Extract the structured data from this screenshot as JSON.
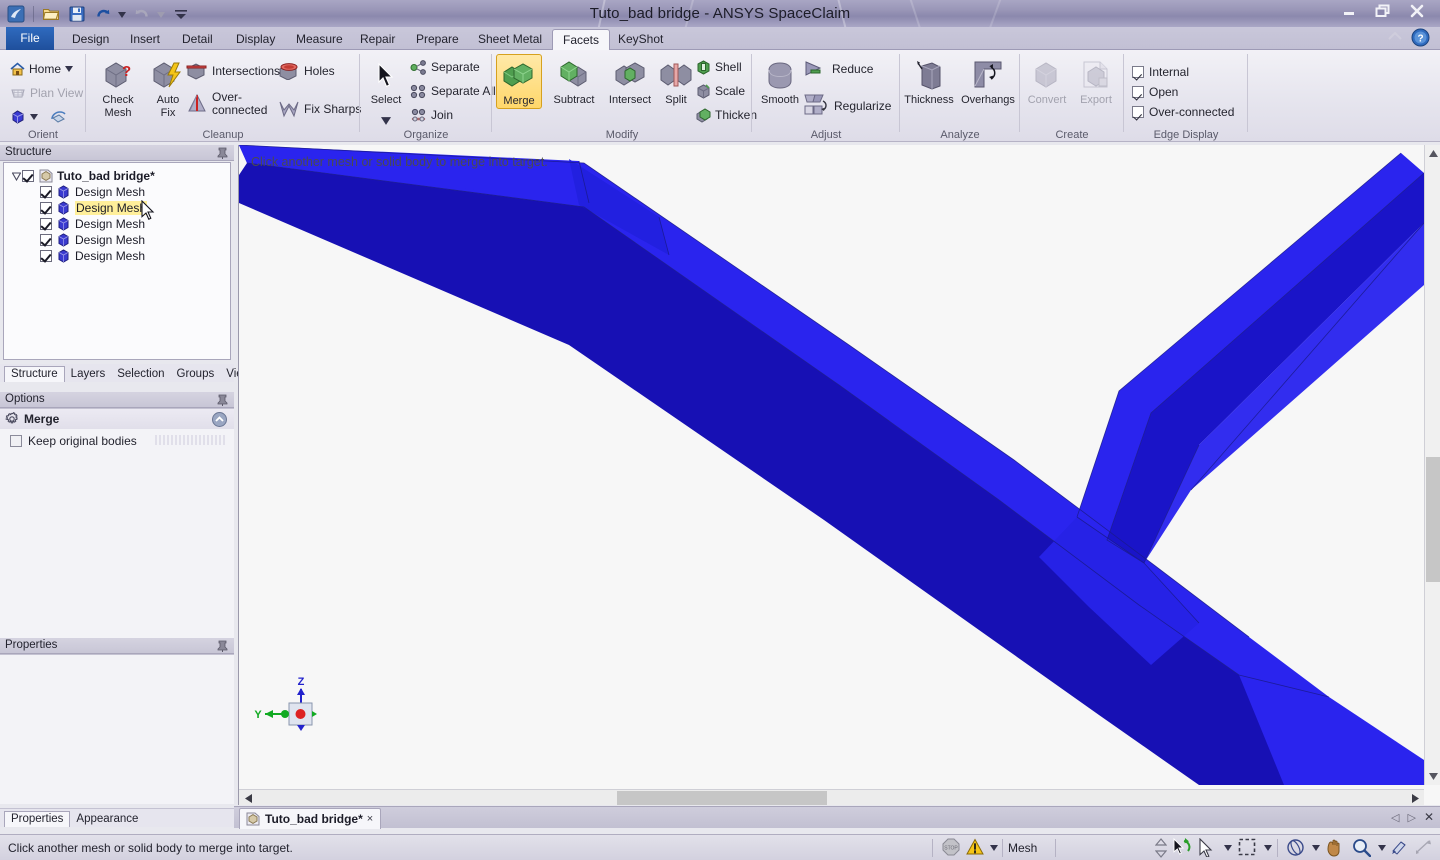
{
  "window": {
    "title": "Tuto_bad bridge - ANSYS SpaceClaim",
    "minimize_label": "Minimize",
    "restore_label": "Restore",
    "close_label": "Close"
  },
  "quick_access": {
    "app_icon": "spaceclaim-logo-icon",
    "items": [
      {
        "name": "open-icon",
        "label": "Open"
      },
      {
        "name": "save-icon",
        "label": "Save"
      },
      {
        "name": "undo-icon",
        "label": "Undo"
      },
      {
        "name": "redo-icon",
        "label": "Redo"
      },
      {
        "name": "customize-qat-icon",
        "label": "Customize Quick Access Toolbar"
      }
    ]
  },
  "tabs": [
    {
      "label": "File",
      "active": false,
      "file": true
    },
    {
      "label": "Design",
      "active": false
    },
    {
      "label": "Insert",
      "active": false
    },
    {
      "label": "Detail",
      "active": false
    },
    {
      "label": "Display",
      "active": false
    },
    {
      "label": "Measure",
      "active": false
    },
    {
      "label": "Repair",
      "active": false
    },
    {
      "label": "Prepare",
      "active": false
    },
    {
      "label": "Sheet Metal",
      "active": false
    },
    {
      "label": "Facets",
      "active": true
    },
    {
      "label": "KeyShot",
      "active": false
    }
  ],
  "ribbon": {
    "groups": [
      {
        "name": "orient",
        "label": "Orient"
      },
      {
        "name": "cleanup",
        "label": "Cleanup"
      },
      {
        "name": "organize",
        "label": "Organize"
      },
      {
        "name": "modify",
        "label": "Modify"
      },
      {
        "name": "adjust",
        "label": "Adjust"
      },
      {
        "name": "analyze",
        "label": "Analyze"
      },
      {
        "name": "create",
        "label": "Create"
      },
      {
        "name": "edge_display",
        "label": "Edge Display"
      }
    ],
    "orient": {
      "home_label": "Home",
      "plan_view_label": "Plan View",
      "view_icon": "view-cube-icon",
      "spin_icon": "spin-view-icon"
    },
    "cleanup": {
      "check_mesh_label": "Check\nMesh",
      "check_mesh_line1": "Check",
      "check_mesh_line2": "Mesh",
      "auto_fix_line1": "Auto",
      "auto_fix_line2": "Fix",
      "intersections_label": "Intersections",
      "holes_label": "Holes",
      "over_connected_line1": "Over-",
      "over_connected_line2": "connected",
      "fix_sharps_label": "Fix Sharps"
    },
    "organize": {
      "select_label": "Select",
      "separate_label": "Separate",
      "separate_all_label": "Separate All",
      "join_label": "Join"
    },
    "modify": {
      "merge_label": "Merge",
      "merge_selected": true,
      "subtract_label": "Subtract",
      "intersect_label": "Intersect",
      "split_label": "Split",
      "shell_label": "Shell",
      "scale_label": "Scale",
      "thicken_label": "Thicken"
    },
    "adjust": {
      "smooth_label": "Smooth",
      "reduce_label": "Reduce",
      "regularize_label": "Regularize"
    },
    "analyze": {
      "thickness_label": "Thickness",
      "overhangs_label": "Overhangs"
    },
    "create": {
      "convert_label": "Convert",
      "convert_disabled": true,
      "export_label": "Export",
      "export_disabled": true
    },
    "edge_display": {
      "internal_label": "Internal",
      "internal_checked": true,
      "open_label": "Open",
      "open_checked": true,
      "over_connected_label": "Over-connected",
      "over_connected_checked": true
    },
    "help_icon": "help-icon",
    "collapse_icon": "collapse-ribbon-icon"
  },
  "structure": {
    "title": "Structure",
    "root": {
      "label": "Tuto_bad bridge*",
      "checked": true,
      "expanded": true
    },
    "children": [
      {
        "label": "Design Mesh",
        "checked": true,
        "highlighted": false
      },
      {
        "label": "Design Mesh",
        "checked": true,
        "highlighted": true
      },
      {
        "label": "Design Mesh",
        "checked": true,
        "highlighted": false
      },
      {
        "label": "Design Mesh",
        "checked": true,
        "highlighted": false
      },
      {
        "label": "Design Mesh",
        "checked": true,
        "highlighted": false
      }
    ],
    "panel_tabs": [
      {
        "label": "Structure",
        "active": true
      },
      {
        "label": "Layers",
        "active": false
      },
      {
        "label": "Selection",
        "active": false
      },
      {
        "label": "Groups",
        "active": false
      },
      {
        "label": "Views",
        "active": false
      }
    ]
  },
  "options": {
    "title": "Options",
    "tool_name": "Merge",
    "tool_icon": "gear-icon",
    "keep_original_bodies_label": "Keep original bodies",
    "keep_original_bodies_checked": false
  },
  "properties": {
    "title": "Properties",
    "panel_tabs": [
      {
        "label": "Properties",
        "active": true
      },
      {
        "label": "Appearance",
        "active": false
      }
    ]
  },
  "viewport": {
    "message": "Click another mesh or solid body to merge into target.",
    "background_color": "#f7f7f7",
    "triad": {
      "z_label": "Z",
      "y_label": "Y",
      "z_color": "#2222cc",
      "y_color": "#11aa22",
      "x_dot_color": "#dd2222"
    },
    "geometry": {
      "face_light": "#2a24ee",
      "face_mid": "#2018dd",
      "face_dark": "#1710b4",
      "edge_color": "#1a1a8c"
    }
  },
  "doc_tabs": [
    {
      "label": "Tuto_bad bridge*",
      "active": true,
      "close": "×"
    }
  ],
  "doc_nav": {
    "prev": "◁",
    "next": "▷",
    "close": "✕"
  },
  "statusbar": {
    "message": "Click another mesh or solid body to merge into target.",
    "mesh_label": "Mesh",
    "icons": [
      {
        "name": "stop-icon",
        "label": "Stop"
      },
      {
        "name": "warning-icon",
        "label": "Warning"
      },
      {
        "name": "dropdown-caret-icon",
        "label": "More"
      },
      {
        "name": "spin-stepper-icon",
        "label": "Spin"
      },
      {
        "name": "select-rotate-icon",
        "label": "Select/Rotate"
      },
      {
        "name": "arrow-cursor-icon",
        "label": "Select tool"
      },
      {
        "name": "box-select-icon",
        "label": "Box select"
      },
      {
        "name": "orbit-icon",
        "label": "Orbit"
      },
      {
        "name": "pan-hand-icon",
        "label": "Pan"
      },
      {
        "name": "zoom-icon",
        "label": "Zoom"
      },
      {
        "name": "fit-icon",
        "label": "Zoom extents"
      },
      {
        "name": "previous-view-icon",
        "label": "Previous view"
      }
    ]
  }
}
